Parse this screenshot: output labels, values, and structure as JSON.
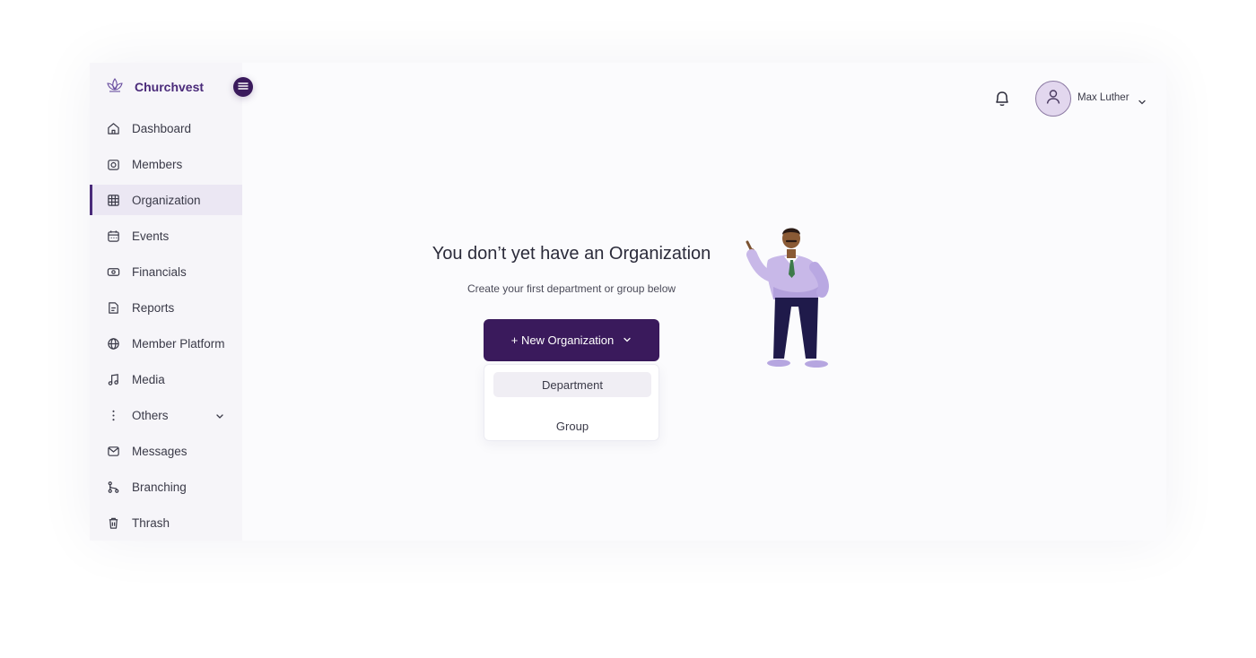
{
  "brand": {
    "name": "Churchvest"
  },
  "sidebar": {
    "items": [
      {
        "label": "Dashboard",
        "icon": "home-icon"
      },
      {
        "label": "Members",
        "icon": "camera-icon"
      },
      {
        "label": "Organization",
        "icon": "building-icon",
        "active": true
      },
      {
        "label": "Events",
        "icon": "calendar-icon"
      },
      {
        "label": "Financials",
        "icon": "money-icon"
      },
      {
        "label": "Reports",
        "icon": "document-icon"
      },
      {
        "label": "Member Platform",
        "icon": "globe-icon"
      },
      {
        "label": "Media",
        "icon": "music-icon"
      },
      {
        "label": "Others",
        "icon": "more-vertical-icon",
        "expandable": true
      },
      {
        "label": "Messages",
        "icon": "mail-icon"
      },
      {
        "label": "Branching",
        "icon": "branch-icon"
      },
      {
        "label": "Thrash",
        "icon": "trash-icon"
      }
    ]
  },
  "header": {
    "user_name": "Max Luther"
  },
  "empty_state": {
    "title": "You don’t yet have an Organization",
    "subtitle": "Create your first department or group below",
    "button_label": "+ New Organization",
    "dropdown_options": [
      "Department",
      "Group"
    ]
  },
  "colors": {
    "accent": "#3a1a5c",
    "brand_text": "#4a2a7a",
    "sidebar_bg": "#f6f5f9",
    "active_bg": "#ebe7f3"
  }
}
